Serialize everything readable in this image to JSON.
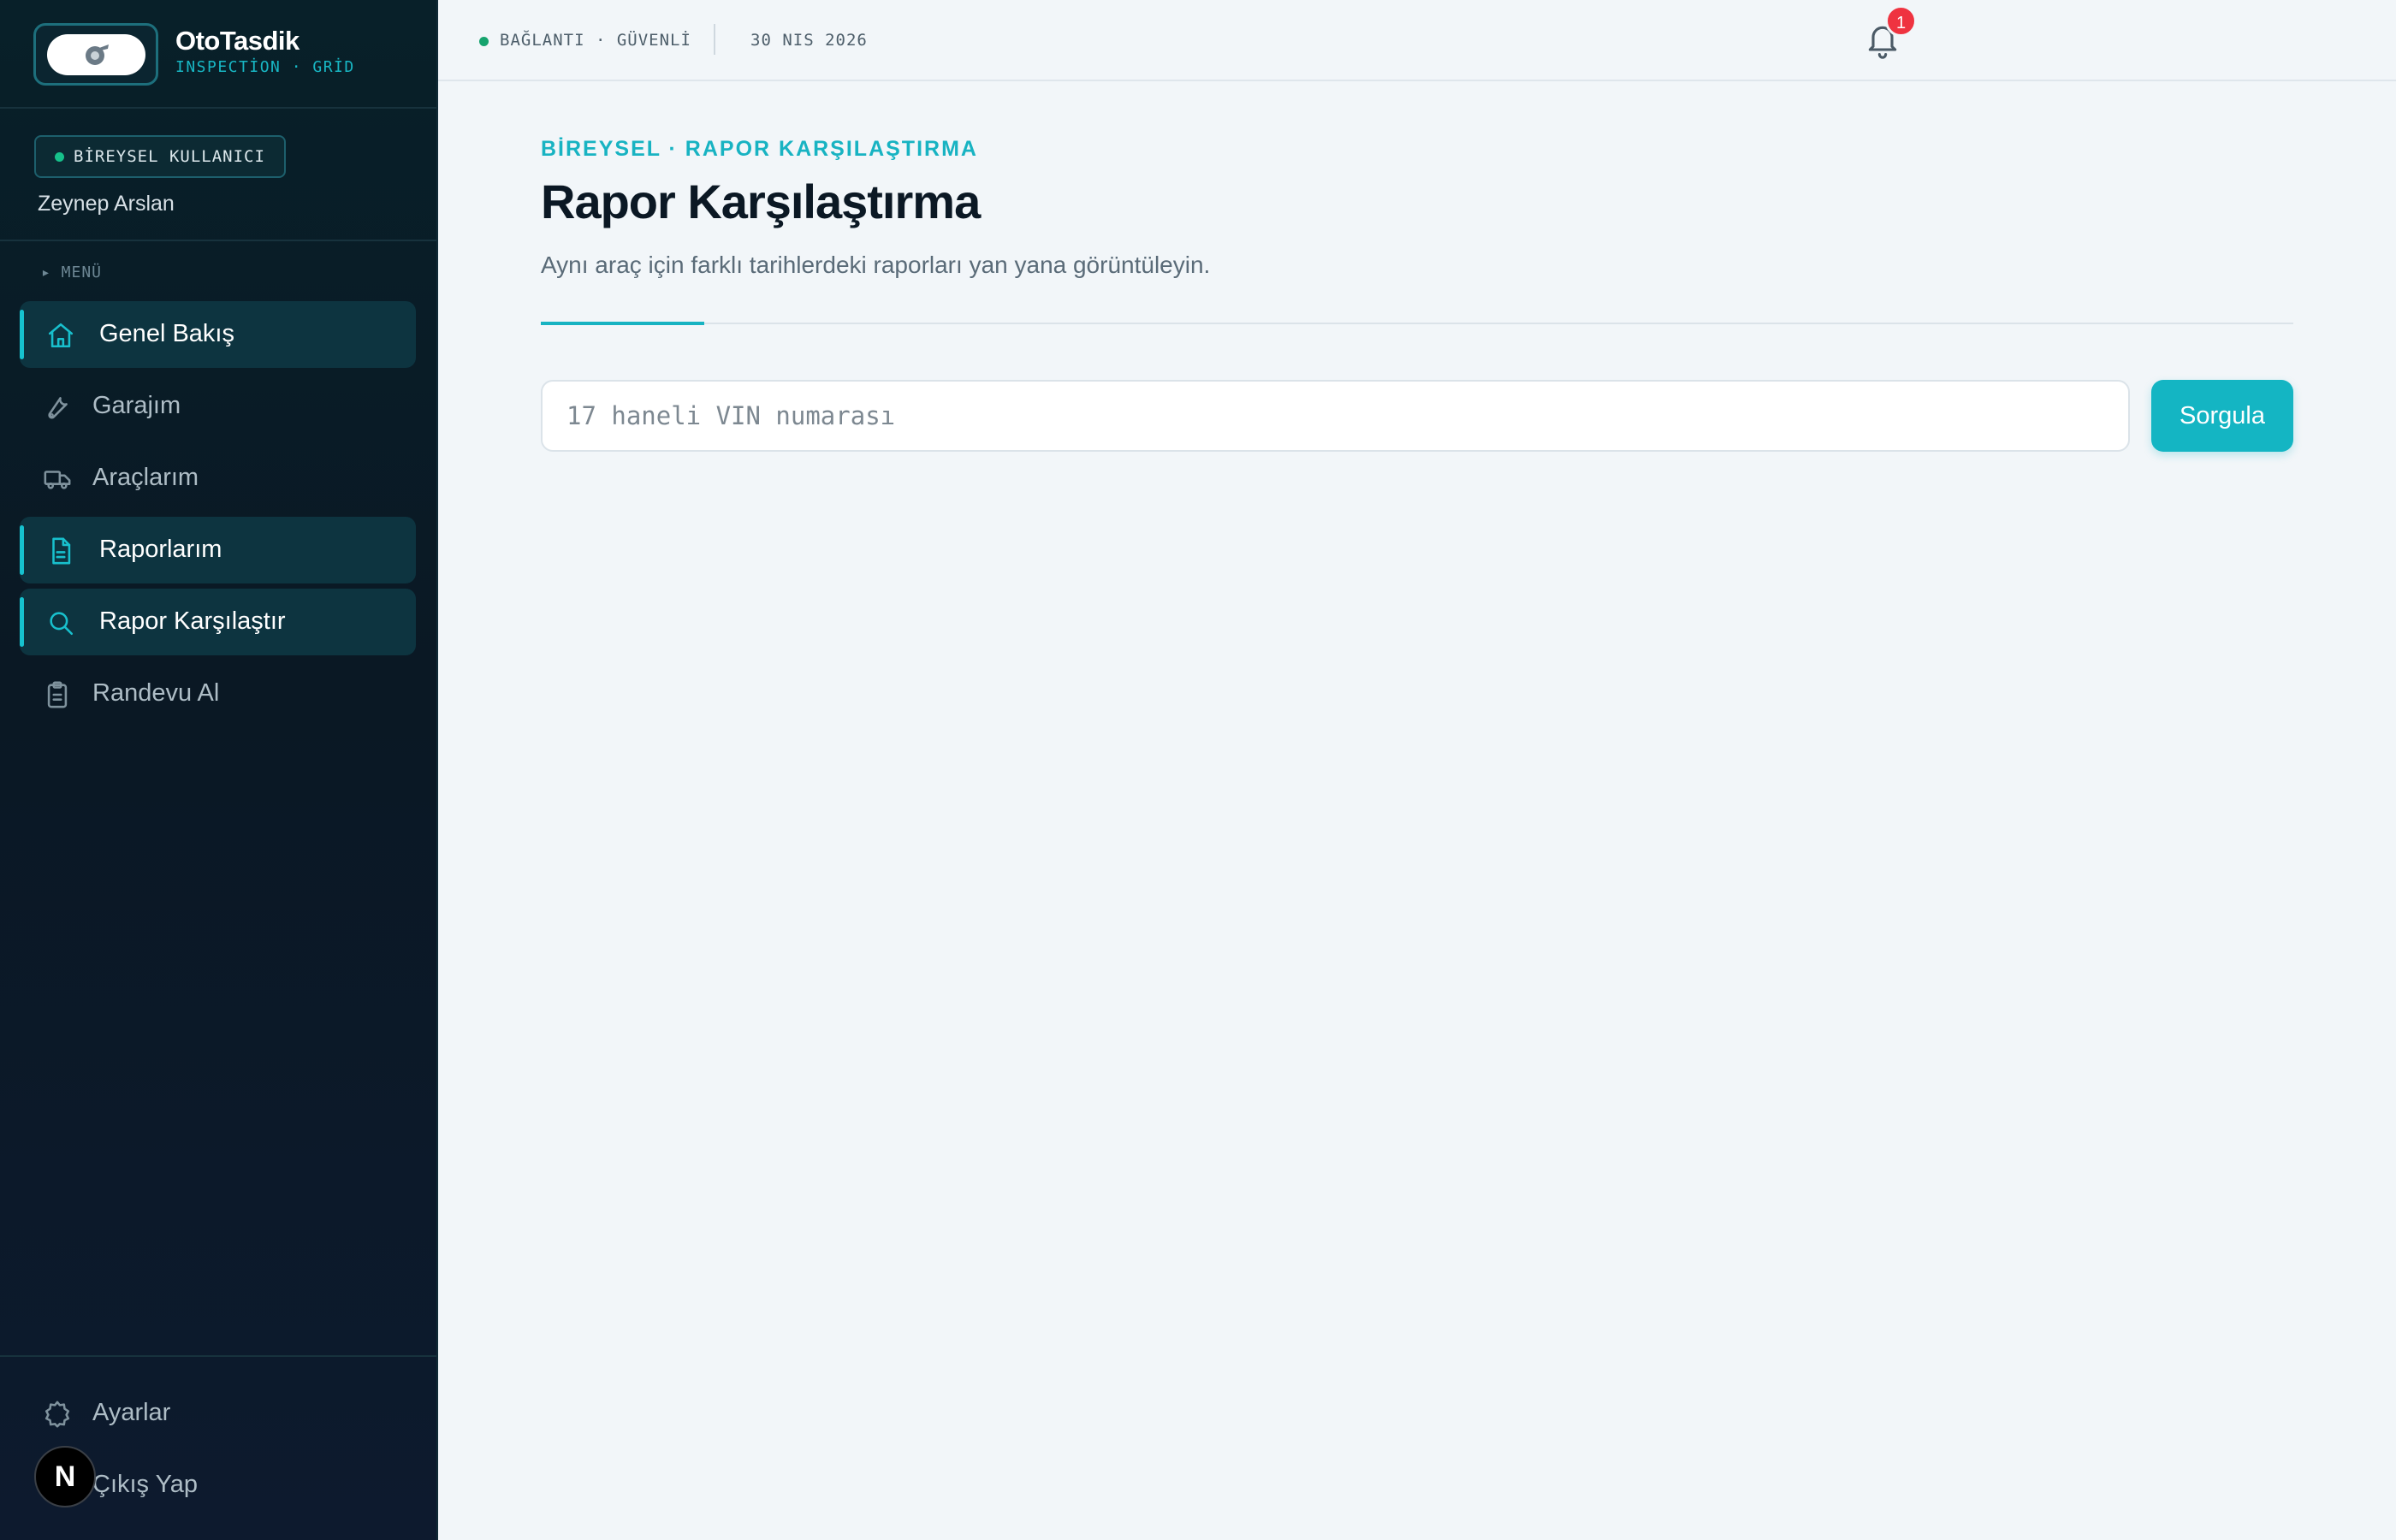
{
  "brand": {
    "name": "OtoTasdik",
    "subtitle": "INSPECTİON · GRİD"
  },
  "user": {
    "role_badge": "BİREYSEL KULLANICI",
    "name": "Zeynep Arslan"
  },
  "sidebar": {
    "menu_title": "▸ MENÜ",
    "items": [
      {
        "label": "Genel Bakış",
        "icon": "home-icon",
        "active": true
      },
      {
        "label": "Garajım",
        "icon": "wrench-icon",
        "active": false
      },
      {
        "label": "Araçlarım",
        "icon": "truck-icon",
        "active": false
      },
      {
        "label": "Raporlarım",
        "icon": "document-icon",
        "active": true
      },
      {
        "label": "Rapor Karşılaştır",
        "icon": "search-icon",
        "active": true
      },
      {
        "label": "Randevu Al",
        "icon": "clipboard-icon",
        "active": false
      }
    ],
    "bottom": [
      {
        "label": "Ayarlar",
        "icon": "gear-icon"
      },
      {
        "label": "Çıkış Yap",
        "icon": "logout-icon"
      }
    ],
    "avatar_letter": "N"
  },
  "topbar": {
    "connection": "BAĞLANTI · GÜVENLİ",
    "date": "30 NIS 2026",
    "notification_count": "1"
  },
  "main": {
    "eyebrow": "BİREYSEL · RAPOR KARŞILAŞTIRMA",
    "title": "Rapor Karşılaştırma",
    "subtitle": "Aynı araç için farklı tarihlerdeki raporları yan yana görüntüleyin.",
    "vin_placeholder": "17 haneli VIN numarası",
    "vin_value": "",
    "query_button": "Sorgula"
  },
  "colors": {
    "accent": "#14b5c3",
    "sidebar_bg": "#0a1824",
    "status_green": "#16a36e",
    "badge_red": "#ef3340"
  }
}
